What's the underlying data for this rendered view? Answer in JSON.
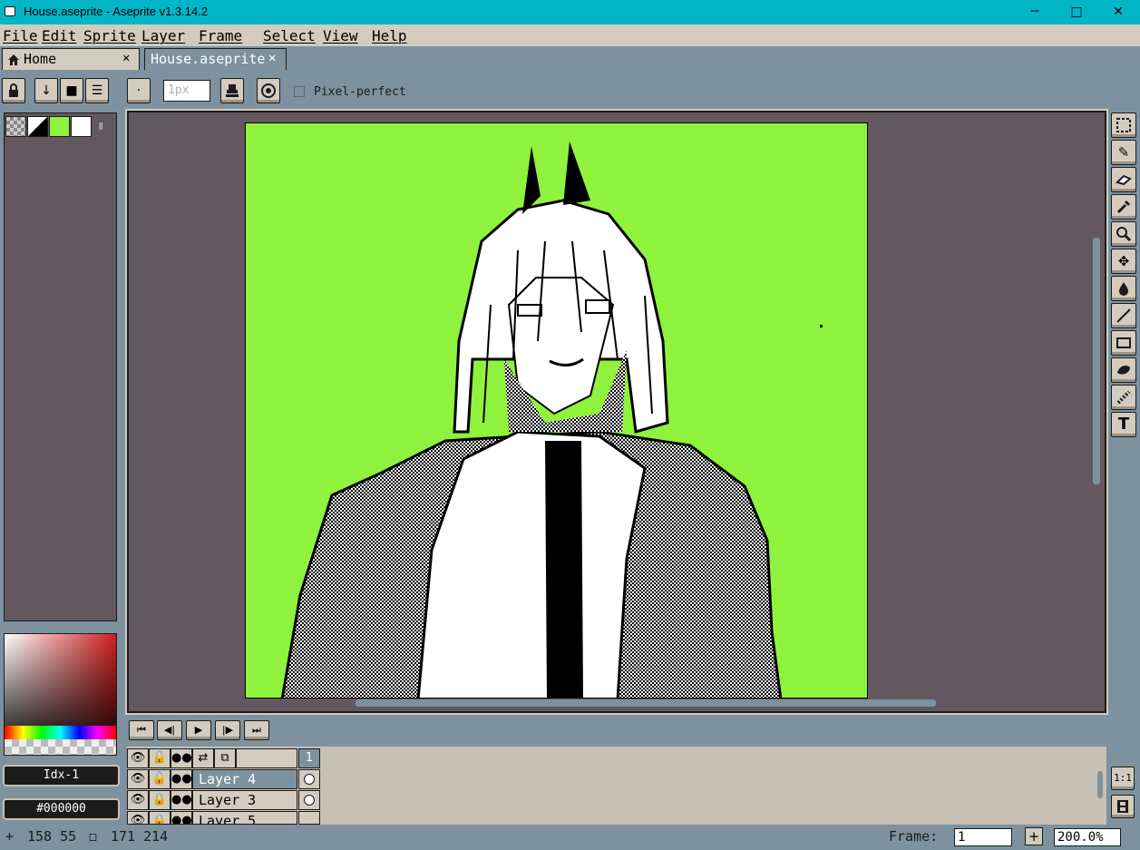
{
  "window": {
    "title": "House.aseprite - Aseprite v1.3.14.2",
    "minimize_glyph": "─",
    "maximize_glyph": "□",
    "close_glyph": "✕"
  },
  "menu": [
    "File",
    "Edit",
    "Sprite",
    "Layer",
    "Frame",
    "Select",
    "View",
    "Help"
  ],
  "tabs": [
    {
      "label": "Home",
      "icon": "home-icon",
      "close": "✕",
      "active": false
    },
    {
      "label": "House.aseprite",
      "close": "✕",
      "active": true
    }
  ],
  "context_bar": {
    "brush_size_placeholder": "1px",
    "pixel_perfect_label": "Pixel-perfect",
    "pixel_perfect_checked": false
  },
  "palette": {
    "colors": [
      "#8ff23c",
      "#ffffff",
      "#000000"
    ],
    "index_field": "Idx-1",
    "hex_field": "#000000"
  },
  "tools": [
    "rectangular-marquee",
    "pencil",
    "eraser",
    "eyedropper",
    "zoom",
    "move",
    "paint-bucket",
    "line",
    "rectangle",
    "contour",
    "blur",
    "text"
  ],
  "timeline": {
    "frame_header": "1",
    "layers": [
      {
        "name": "Layer 4",
        "selected": true
      },
      {
        "name": "Layer 3",
        "selected": false
      },
      {
        "name": "Layer 5",
        "selected": false
      }
    ],
    "side_buttons": [
      "1:1",
      "film-icon"
    ]
  },
  "status": {
    "cursor_pos": "158 55",
    "selection_size": "171 214",
    "frame_label": "Frame:",
    "frame_value": "1",
    "zoom_value": "200.0%"
  },
  "colors": {
    "titlebar": "#00b5c6",
    "canvas_bg": "#8ff23c",
    "workspace": "#635860",
    "ui_face": "#d3cbbe",
    "ui_shell": "#7d929e"
  }
}
